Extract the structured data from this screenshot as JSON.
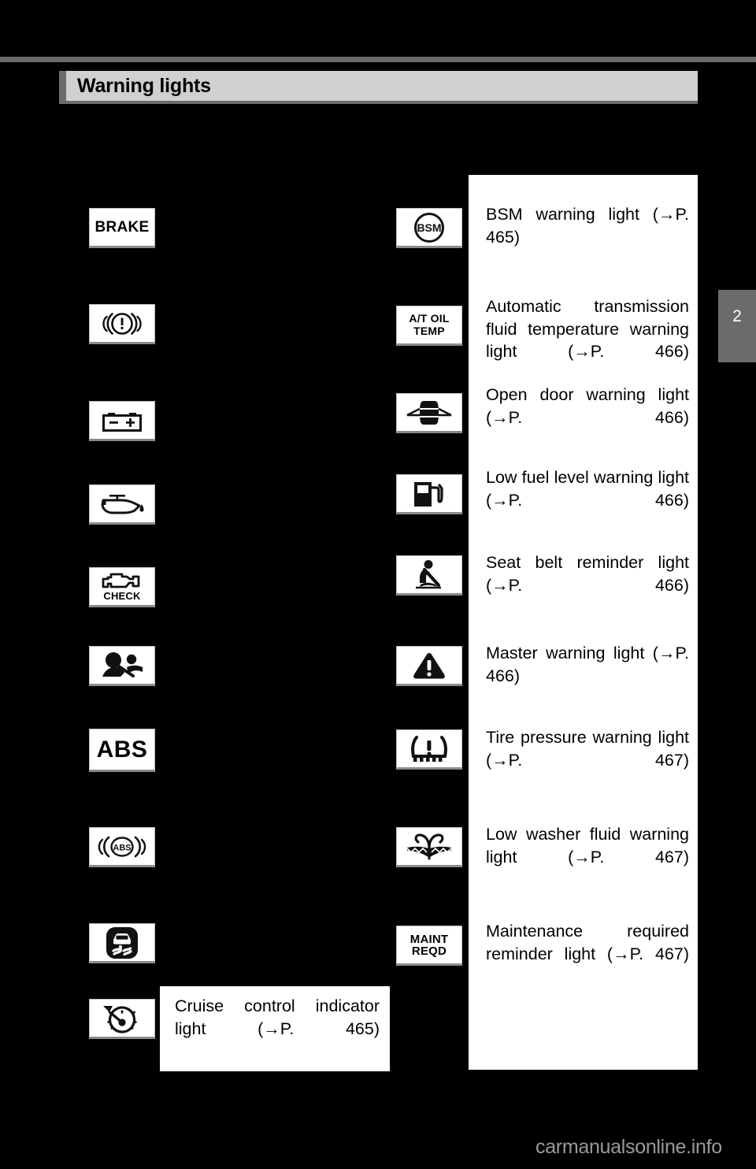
{
  "header": {
    "title": "Warning lights"
  },
  "page_tab": {
    "number": "2"
  },
  "watermark": {
    "text": "carmanualsonline.info"
  },
  "left_column": [
    {
      "icon_name": "brake-warning-icon",
      "icon_label": "BRAKE"
    },
    {
      "icon_name": "brake-system-warning-icon",
      "icon_label": ""
    },
    {
      "icon_name": "charging-system-warning-icon",
      "icon_label": ""
    },
    {
      "icon_name": "low-engine-oil-pressure-icon",
      "icon_label": ""
    },
    {
      "icon_name": "malfunction-indicator-icon",
      "icon_label": "CHECK"
    },
    {
      "icon_name": "srs-airbag-warning-icon",
      "icon_label": ""
    },
    {
      "icon_name": "abs-warning-icon",
      "icon_label": "ABS"
    },
    {
      "icon_name": "brake-assist-warning-icon",
      "icon_label": "ABS"
    },
    {
      "icon_name": "skid-control-warning-icon",
      "icon_label": ""
    },
    {
      "icon_name": "cruise-control-indicator-icon",
      "icon_label": ""
    }
  ],
  "cruise_entry": {
    "description": "Cruise control indicator light (→P. 465)"
  },
  "right_column": [
    {
      "icon_name": "bsm-warning-icon",
      "icon_label": "BSM",
      "description": "BSM warning light (→P. 465)"
    },
    {
      "icon_name": "at-oil-temp-warning-icon",
      "icon_label": "A/T OIL TEMP",
      "description": "Automatic transmission fluid temperature warning light (→P. 466)"
    },
    {
      "icon_name": "open-door-warning-icon",
      "icon_label": "",
      "description": "Open door warning light (→P. 466)"
    },
    {
      "icon_name": "low-fuel-level-warning-icon",
      "icon_label": "",
      "description": "Low fuel level warning light (→P. 466)"
    },
    {
      "icon_name": "seat-belt-reminder-icon",
      "icon_label": "",
      "description": "Seat belt reminder light (→P. 466)"
    },
    {
      "icon_name": "master-warning-icon",
      "icon_label": "",
      "description": "Master warning light (→P. 466)"
    },
    {
      "icon_name": "tire-pressure-warning-icon",
      "icon_label": "",
      "description": "Tire pressure warning light (→P. 467)"
    },
    {
      "icon_name": "low-washer-fluid-warning-icon",
      "icon_label": "",
      "description": "Low washer fluid warning light (→P. 467)"
    },
    {
      "icon_name": "maintenance-required-icon",
      "icon_label": "MAINT REQD",
      "description": "Maintenance required reminder light (→P. 467)"
    }
  ]
}
